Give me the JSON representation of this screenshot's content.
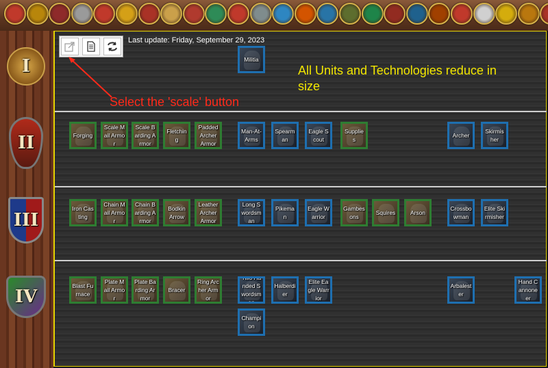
{
  "page": {
    "last_update": "Last update: Friday, September 29, 2023"
  },
  "civ_bar": {
    "civs": [
      {
        "icon": "civ-emblem-icon",
        "color": "#c0392b"
      },
      {
        "icon": "civ-emblem-icon",
        "color": "#b8860b"
      },
      {
        "icon": "civ-emblem-icon",
        "color": "#8e2a2a"
      },
      {
        "icon": "civ-emblem-icon",
        "color": "#9a9a9a"
      },
      {
        "icon": "civ-emblem-icon",
        "color": "#c0392b"
      },
      {
        "icon": "civ-emblem-icon",
        "color": "#d4a017"
      },
      {
        "icon": "civ-emblem-icon",
        "color": "#a93226"
      },
      {
        "icon": "civ-emblem-icon",
        "color": "#caa04a"
      },
      {
        "icon": "civ-emblem-icon",
        "color": "#b03a2e"
      },
      {
        "icon": "civ-emblem-icon",
        "color": "#2e8b57"
      },
      {
        "icon": "civ-emblem-icon",
        "color": "#c0392b"
      },
      {
        "icon": "civ-emblem-icon",
        "color": "#7f8c8d"
      },
      {
        "icon": "civ-emblem-icon",
        "color": "#2e86c1"
      },
      {
        "icon": "civ-emblem-icon",
        "color": "#d35400"
      },
      {
        "icon": "civ-emblem-icon",
        "color": "#2874a6"
      },
      {
        "icon": "civ-emblem-icon",
        "color": "#5d6d2e"
      },
      {
        "icon": "civ-emblem-icon",
        "color": "#1e8449"
      },
      {
        "icon": "civ-emblem-icon",
        "color": "#922b21"
      },
      {
        "icon": "civ-emblem-icon",
        "color": "#1f618d"
      },
      {
        "icon": "civ-emblem-icon",
        "color": "#a04000"
      },
      {
        "icon": "civ-emblem-icon",
        "color": "#c0392b"
      },
      {
        "icon": "civ-emblem-icon",
        "color": "#d0d0d0"
      },
      {
        "icon": "civ-emblem-icon",
        "color": "#d4ac0d"
      },
      {
        "icon": "civ-emblem-icon",
        "color": "#b9770e"
      },
      {
        "icon": "civ-emblem-icon",
        "color": "#a93226"
      }
    ]
  },
  "toolbar": {
    "scale_icon": "scale-icon",
    "document_icon": "document-icon",
    "refresh_icon": "refresh-icon"
  },
  "annotations": {
    "yellow_note": "All Units and Technologies reduce in size",
    "red_note": "Select the 'scale' button"
  },
  "ages": [
    {
      "roman": "I",
      "emblem": "dark-age-emblem-icon"
    },
    {
      "roman": "II",
      "emblem": "feudal-age-emblem-icon"
    },
    {
      "roman": "III",
      "emblem": "castle-age-emblem-icon"
    },
    {
      "roman": "IV",
      "emblem": "imperial-age-emblem-icon"
    }
  ],
  "tiles": [
    {
      "label": "Militia",
      "kind": "unit"
    },
    {
      "label": "Forging",
      "kind": "tech"
    },
    {
      "label": "Scale Mail Armor",
      "kind": "tech"
    },
    {
      "label": "Scale Barding Armor",
      "kind": "tech"
    },
    {
      "label": "Fletching",
      "kind": "tech"
    },
    {
      "label": "Padded Archer Armor",
      "kind": "tech"
    },
    {
      "label": "Man-At-Arms",
      "kind": "unit"
    },
    {
      "label": "Spearman",
      "kind": "unit"
    },
    {
      "label": "Eagle Scout",
      "kind": "unit"
    },
    {
      "label": "Supplies",
      "kind": "tech"
    },
    {
      "label": "Archer",
      "kind": "unit"
    },
    {
      "label": "Skirmisher",
      "kind": "unit"
    },
    {
      "label": "Iron Casting",
      "kind": "tech"
    },
    {
      "label": "Chain Mail Armor",
      "kind": "tech"
    },
    {
      "label": "Chain Barding Armor",
      "kind": "tech"
    },
    {
      "label": "Bodkin Arrow",
      "kind": "tech"
    },
    {
      "label": "Leather Archer Armor",
      "kind": "tech"
    },
    {
      "label": "Long Swordsman",
      "kind": "unit"
    },
    {
      "label": "Pikeman",
      "kind": "unit"
    },
    {
      "label": "Eagle Warrior",
      "kind": "unit"
    },
    {
      "label": "Gambesons",
      "kind": "tech"
    },
    {
      "label": "Squires",
      "kind": "tech"
    },
    {
      "label": "Arson",
      "kind": "tech"
    },
    {
      "label": "Crossbowman",
      "kind": "unit"
    },
    {
      "label": "Elite Skirmisher",
      "kind": "unit"
    },
    {
      "label": "Blast Furnace",
      "kind": "tech"
    },
    {
      "label": "Plate Mail Armor",
      "kind": "tech"
    },
    {
      "label": "Plate Barding Armor",
      "kind": "tech"
    },
    {
      "label": "Bracer",
      "kind": "tech"
    },
    {
      "label": "Ring Archer Armor",
      "kind": "tech"
    },
    {
      "label": "Two Handed Swordsman",
      "kind": "unit"
    },
    {
      "label": "Halberdier",
      "kind": "unit"
    },
    {
      "label": "Elite Eagle Warrior",
      "kind": "unit"
    },
    {
      "label": "Arbalester",
      "kind": "unit"
    },
    {
      "label": "Hand Cannoneer",
      "kind": "unit"
    },
    {
      "label": "Champion",
      "kind": "unit"
    }
  ]
}
